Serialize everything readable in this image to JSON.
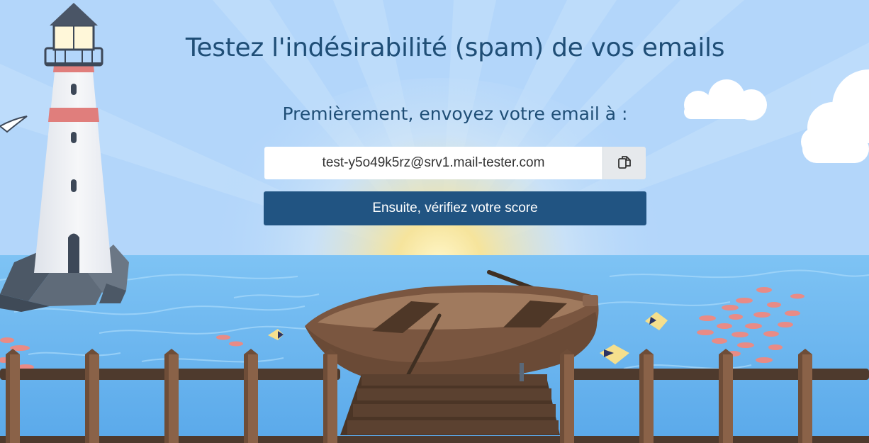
{
  "header": {
    "title": "Testez l'indésirabilité (spam) de vos emails"
  },
  "step": {
    "instruction": "Premièrement, envoyez votre email à :"
  },
  "email": {
    "address": "test-y5o49k5rz@srv1.mail-tester.com",
    "copy_icon": "copy-icon"
  },
  "actions": {
    "check_label": "Ensuite, vérifiez votre score"
  },
  "colors": {
    "primary": "#215482",
    "title": "#1f4e76",
    "sky": "#b3d6fa",
    "sea": "#6fb8f0"
  }
}
